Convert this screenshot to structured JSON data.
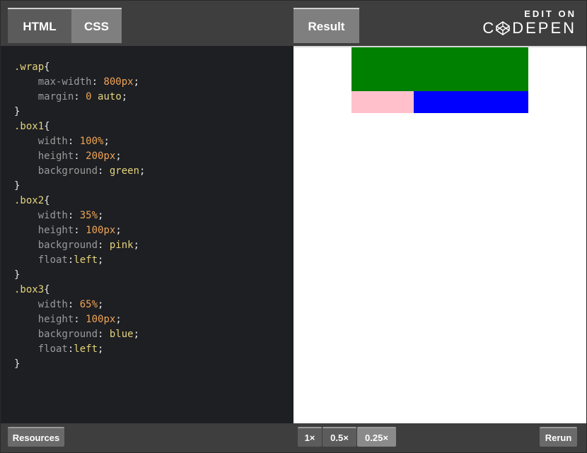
{
  "tabs": {
    "html": "HTML",
    "css": "CSS",
    "result": "Result"
  },
  "brand": {
    "edit_on": "EDIT ON",
    "name": "DEPEN",
    "logo_icon": "codepen-cube-icon"
  },
  "code_lines": [
    [
      [
        ".wrap",
        "sel"
      ],
      [
        "{",
        "brace"
      ]
    ],
    [
      [
        "    max-width",
        "prop"
      ],
      [
        ": ",
        "punct"
      ],
      [
        "800px",
        "num"
      ],
      [
        ";",
        "punct"
      ]
    ],
    [
      [
        "    margin",
        "prop"
      ],
      [
        ": ",
        "punct"
      ],
      [
        "0",
        "num"
      ],
      [
        " ",
        "punct"
      ],
      [
        "auto",
        "kw"
      ],
      [
        ";",
        "punct"
      ]
    ],
    [
      [
        "}",
        "brace"
      ]
    ],
    [
      [
        ".box1",
        "sel"
      ],
      [
        "{",
        "brace"
      ]
    ],
    [
      [
        "    width",
        "prop"
      ],
      [
        ": ",
        "punct"
      ],
      [
        "100%",
        "num"
      ],
      [
        ";",
        "punct"
      ]
    ],
    [
      [
        "    height",
        "prop"
      ],
      [
        ": ",
        "punct"
      ],
      [
        "200px",
        "num"
      ],
      [
        ";",
        "punct"
      ]
    ],
    [
      [
        "    background",
        "prop"
      ],
      [
        ": ",
        "punct"
      ],
      [
        "green",
        "kw"
      ],
      [
        ";",
        "punct"
      ]
    ],
    [
      [
        "}",
        "brace"
      ]
    ],
    [
      [
        ".box2",
        "sel"
      ],
      [
        "{",
        "brace"
      ]
    ],
    [
      [
        "    width",
        "prop"
      ],
      [
        ": ",
        "punct"
      ],
      [
        "35%",
        "num"
      ],
      [
        ";",
        "punct"
      ]
    ],
    [
      [
        "    height",
        "prop"
      ],
      [
        ": ",
        "punct"
      ],
      [
        "100px",
        "num"
      ],
      [
        ";",
        "punct"
      ]
    ],
    [
      [
        "    background",
        "prop"
      ],
      [
        ": ",
        "punct"
      ],
      [
        "pink",
        "kw"
      ],
      [
        ";",
        "punct"
      ]
    ],
    [
      [
        "    float",
        "prop"
      ],
      [
        ":",
        "punct"
      ],
      [
        "left",
        "kw"
      ],
      [
        ";",
        "punct"
      ]
    ],
    [
      [
        "}",
        "brace"
      ]
    ],
    [
      [
        ".box3",
        "sel"
      ],
      [
        "{",
        "brace"
      ]
    ],
    [
      [
        "    width",
        "prop"
      ],
      [
        ": ",
        "punct"
      ],
      [
        "65%",
        "num"
      ],
      [
        ";",
        "punct"
      ]
    ],
    [
      [
        "    height",
        "prop"
      ],
      [
        ": ",
        "punct"
      ],
      [
        "100px",
        "num"
      ],
      [
        ";",
        "punct"
      ]
    ],
    [
      [
        "    background",
        "prop"
      ],
      [
        ": ",
        "punct"
      ],
      [
        "blue",
        "kw"
      ],
      [
        ";",
        "punct"
      ]
    ],
    [
      [
        "    float",
        "prop"
      ],
      [
        ":",
        "punct"
      ],
      [
        "left",
        "kw"
      ],
      [
        ";",
        "punct"
      ]
    ],
    [
      [
        "}",
        "brace"
      ]
    ]
  ],
  "footer": {
    "resources": "Resources",
    "zoom_1x": "1×",
    "zoom_05x": "0.5×",
    "zoom_025x": "0.25×",
    "rerun": "Rerun"
  },
  "colors": {
    "box1": "green",
    "box2": "pink",
    "box3": "blue",
    "code_bg": "#1d1f23"
  }
}
